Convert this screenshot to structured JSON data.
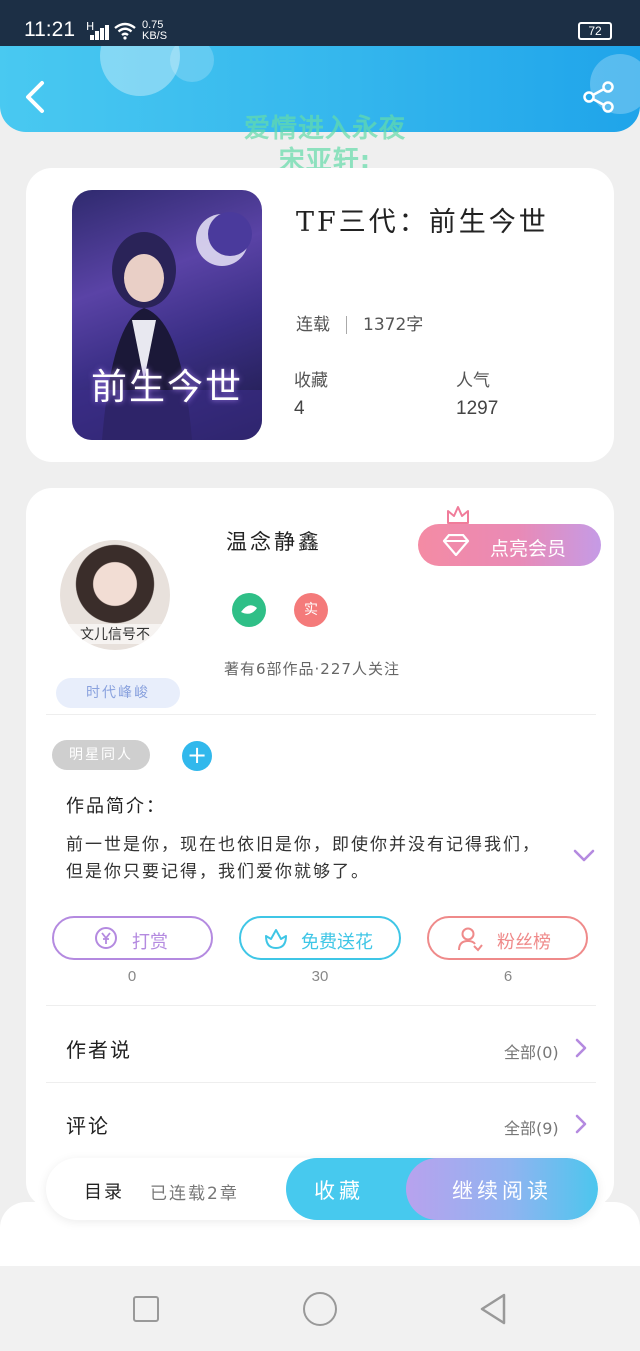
{
  "status_bar": {
    "time": "11:21",
    "signal_label": "H",
    "speed_value": "0.75",
    "speed_unit": "KB/S",
    "battery": "72"
  },
  "header": {
    "back_icon": "chevron-left-icon",
    "share_icon": "share-icon"
  },
  "overlay_text": {
    "line1": "爱情进入永夜",
    "line2": "宋亚轩:"
  },
  "book": {
    "title": "TF三代：前生今世",
    "status": "连载",
    "word_count": "1372字",
    "collect_label": "收藏",
    "collect_value": "4",
    "popularity_label": "人气",
    "popularity_value": "1297",
    "cover_text": "前生今世"
  },
  "author": {
    "name": "温念静鑫",
    "avatar_caption": "文儿信号不",
    "vip_button": "点亮会员",
    "real_badge": "实",
    "stats": "著有6部作品·227人关注",
    "era_tag": "时代峰峻"
  },
  "work": {
    "genre_tag": "明星同人",
    "add_tag": "+",
    "intro_label": "作品简介：",
    "intro_text": "前一世是你，现在也依旧是你，即使你并没有记得我们，但是你只要记得，我们爱你就够了。"
  },
  "actions": [
    {
      "label": "打赏",
      "count": "0",
      "icon": "yen-icon",
      "color": "#b48ae0"
    },
    {
      "label": "免费送花",
      "count": "30",
      "icon": "flower-icon",
      "color": "#3fc6e6"
    },
    {
      "label": "粉丝榜",
      "count": "6",
      "icon": "user-rank-icon",
      "color": "#ef8a8a"
    }
  ],
  "sections": {
    "author_says": {
      "label": "作者说",
      "right": "全部(0)"
    },
    "comments": {
      "label": "评论",
      "right": "全部(9)"
    }
  },
  "bottom_bar": {
    "catalog": "目录",
    "chapters": "已连载2章",
    "collect": "收藏",
    "continue_reading": "继续阅读"
  },
  "colors": {
    "header_blue": "#34b6ed",
    "accent_purple": "#b48ae0",
    "vip_pink": "#f48ba4"
  }
}
